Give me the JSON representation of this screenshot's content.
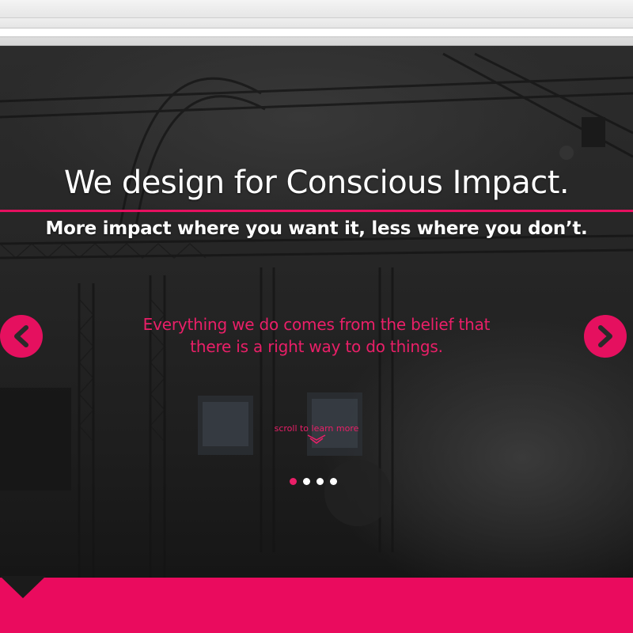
{
  "hero": {
    "headline": "We design for Conscious Impact.",
    "subhead": "More impact where you want it, less where you don’t.",
    "tagline_line1": "Everything we do comes from the belief that",
    "tagline_line2": "there is a right way to do things.",
    "scroll_label": "scroll to learn more",
    "prev_icon": "chevron-left-icon",
    "next_icon": "chevron-right-icon"
  },
  "slider": {
    "slide_count": 4,
    "active_index": 0
  },
  "colors": {
    "accent": "#ea0b5e",
    "text": "#ffffff"
  }
}
